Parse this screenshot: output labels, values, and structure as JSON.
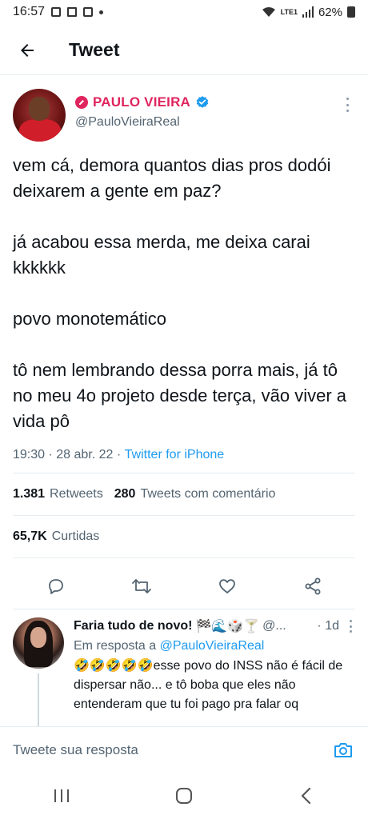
{
  "status_bar": {
    "time": "16:57",
    "network": "LTE1",
    "battery": "62%"
  },
  "topbar": {
    "title": "Tweet"
  },
  "tweet": {
    "display_name": "PAULO VIEIRA",
    "handle": "@PauloVieiraReal",
    "paragraphs": [
      "vem cá, demora quantos dias pros dodói deixarem a gente em paz?",
      "já acabou essa merda, me deixa carai kkkkkk",
      "povo monotemático",
      "tô nem lembrando dessa porra mais, já tô no meu 4o projeto desde terça, vão viver a vida pô"
    ],
    "time": "19:30",
    "date": "28 abr. 22",
    "source": "Twitter for iPhone",
    "separator": " · ",
    "retweets_count": "1.381",
    "retweets_label": "Retweets",
    "quotes_count": "280",
    "quotes_label": "Tweets com comentário",
    "likes_count": "65,7K",
    "likes_label": "Curtidas"
  },
  "reply": {
    "name": "Faria tudo de novo!",
    "emoji_suffix": "🏁🌊🎲🍸",
    "handle_truncated": "@...",
    "time": "· 1d",
    "reply_to_prefix": "Em resposta a",
    "reply_to_handle": "@PauloVieiraReal",
    "emoji_prefix": "🤣🤣🤣🤣🤣",
    "text": "esse povo do INSS não é fácil de dispersar não... e tô boba que eles não entenderam que tu foi pago pra falar oq"
  },
  "compose": {
    "placeholder": "Tweete sua resposta"
  },
  "icons": {
    "back": "arrow-left-icon",
    "verified": "verified-badge-icon",
    "reply": "comment-icon",
    "retweet": "retweet-icon",
    "like": "heart-icon",
    "share": "share-icon",
    "camera": "camera-icon"
  },
  "colors": {
    "accent": "#1d9bf0",
    "name_pink": "#e0245e",
    "secondary_text": "#536471"
  }
}
